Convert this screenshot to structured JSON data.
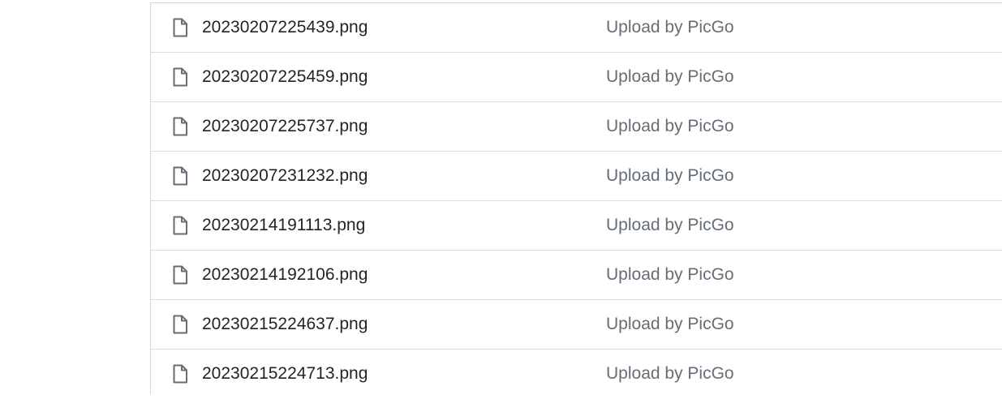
{
  "files": [
    {
      "name": "20230207225439.png",
      "message": "Upload by PicGo",
      "icon": "file-icon"
    },
    {
      "name": "20230207225459.png",
      "message": "Upload by PicGo",
      "icon": "file-icon"
    },
    {
      "name": "20230207225737.png",
      "message": "Upload by PicGo",
      "icon": "file-icon"
    },
    {
      "name": "20230207231232.png",
      "message": "Upload by PicGo",
      "icon": "file-icon"
    },
    {
      "name": "20230214191113.png",
      "message": "Upload by PicGo",
      "icon": "file-icon"
    },
    {
      "name": "20230214192106.png",
      "message": "Upload by PicGo",
      "icon": "file-icon"
    },
    {
      "name": "20230215224637.png",
      "message": "Upload by PicGo",
      "icon": "file-icon"
    },
    {
      "name": "20230215224713.png",
      "message": "Upload by PicGo",
      "icon": "file-icon"
    }
  ],
  "colors": {
    "file_name": "#1f2328",
    "commit_message": "#656d76",
    "border": "#d0d7de"
  }
}
